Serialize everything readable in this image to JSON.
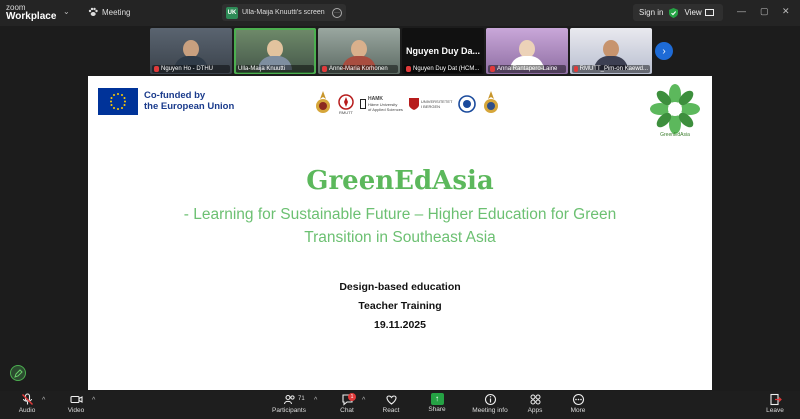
{
  "app": {
    "brand_line1": "zoom",
    "brand_line2": "Workplace",
    "meeting_label": "Meeting"
  },
  "share": {
    "badge": "UK",
    "label": "Ulla-Maija Knuutti's screen"
  },
  "account": {
    "signin_label": "Sign in",
    "view_label": "View"
  },
  "participants_strip": [
    {
      "name": "Nguyen Ho - DTHU"
    },
    {
      "name": "Ulla-Maija Knuutti"
    },
    {
      "name": "Anne-Maria Korhonen"
    },
    {
      "name": "Nguyen Duy Dat (HCM...",
      "big": "Nguyen Duy Da..."
    },
    {
      "name": "Anna Rantapero-Laine"
    },
    {
      "name": "RMUTT_Pim-on Kaewd..."
    }
  ],
  "slide": {
    "eu_line1": "Co-funded by",
    "eu_line2": "the European Union",
    "hamk_line1": "HAMK",
    "hamk_line2": "Häme University",
    "hamk_line3": "of Applied Sciences",
    "bergen_line1": "UNIVERSITETET",
    "bergen_line2": "I BERGEN",
    "rmutt_label": "RMUTT",
    "gea_caption": "GreenEdAsia",
    "title": "GreenEdAsia",
    "subtitle_line1": "- Learning for Sustainable Future – Higher Education for Green",
    "subtitle_line2": "Transition in Southeast Asia",
    "body_line1": "Design-based education",
    "body_line2": "Teacher Training",
    "body_line3": "19.11.2025"
  },
  "toolbar": {
    "audio": "Audio",
    "video": "Video",
    "participants": "Participants",
    "participants_count": "71",
    "chat": "Chat",
    "chat_badge": "1",
    "react": "React",
    "share": "Share",
    "meeting_info": "Meeting info",
    "apps": "Apps",
    "more": "More",
    "leave": "Leave"
  },
  "colors": {
    "accent_green": "#5cb85c",
    "share_green": "#25a244",
    "leave_red": "#e03a3a",
    "next_blue": "#1e6bd6"
  },
  "icons": {
    "meeting": "paw-icon",
    "security": "shield-check-icon",
    "audio": "mic-muted-icon",
    "video": "camera-icon",
    "participants": "people-icon",
    "chat": "chat-bubble-icon",
    "react": "heart-icon",
    "share": "share-up-icon",
    "meeting_info": "info-icon",
    "apps": "apps-icon",
    "more": "more-dots-icon",
    "leave": "leave-icon"
  }
}
